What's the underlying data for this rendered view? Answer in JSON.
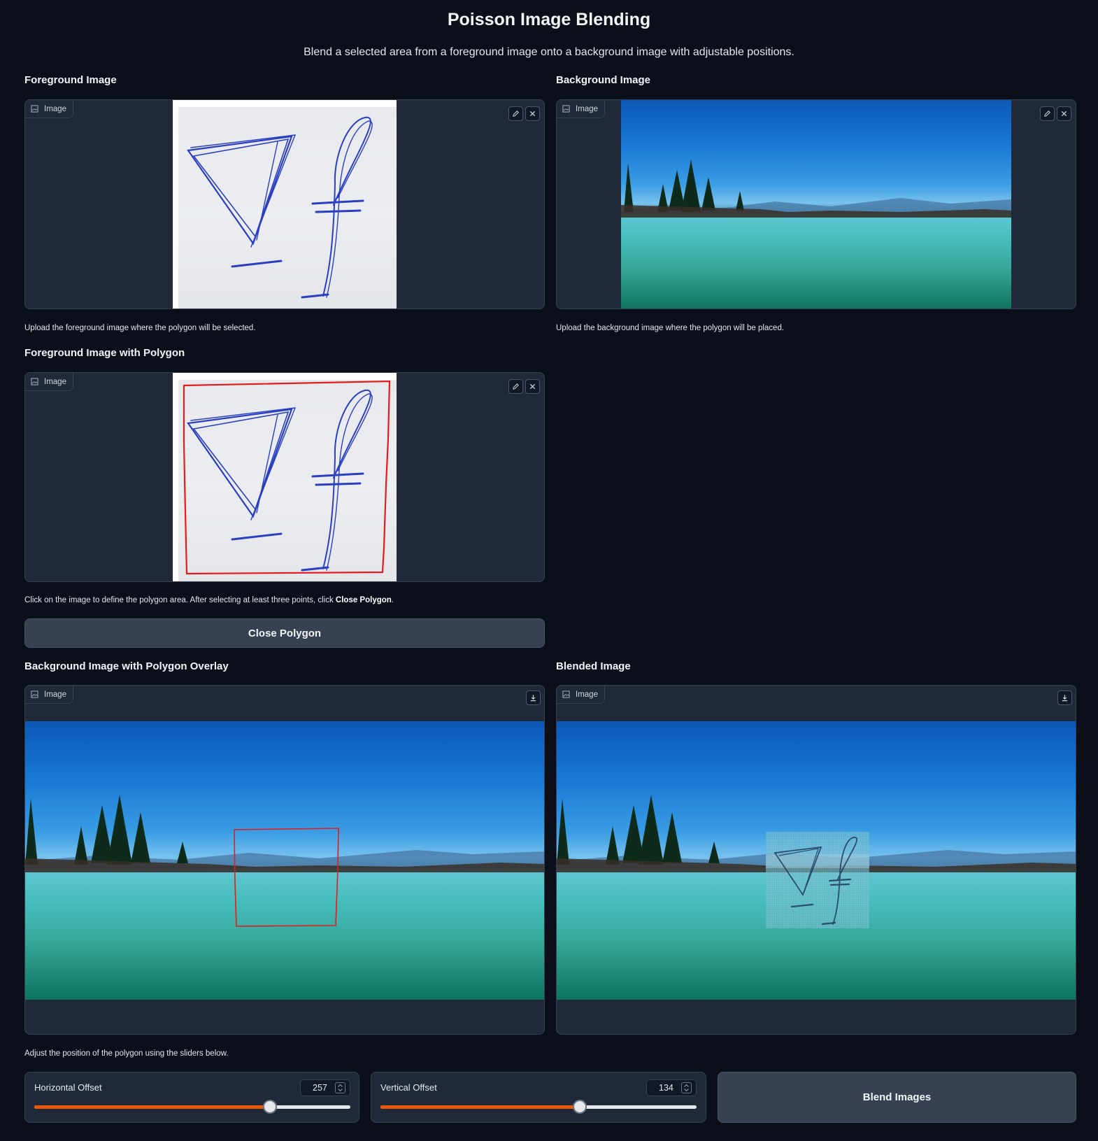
{
  "page": {
    "title": "Poisson Image Blending",
    "subtitle": "Blend a selected area from a foreground image onto a background image with adjustable positions."
  },
  "foreground": {
    "label": "Foreground Image",
    "badge": "Image",
    "hint": "Upload the foreground image where the polygon will be selected."
  },
  "background": {
    "label": "Background Image",
    "badge": "Image",
    "hint": "Upload the background image where the polygon will be placed."
  },
  "polygon": {
    "label": "Foreground Image with Polygon",
    "badge": "Image",
    "hint_prefix": "Click on the image to define the polygon area. After selecting at least three points, click ",
    "hint_bold": "Close Polygon",
    "hint_suffix": ".",
    "close_button": "Close Polygon"
  },
  "overlay": {
    "label": "Background Image with Polygon Overlay",
    "badge": "Image"
  },
  "blended": {
    "label": "Blended Image",
    "badge": "Image"
  },
  "controls": {
    "hint": "Adjust the position of the polygon using the sliders below.",
    "horizontal": {
      "label": "Horizontal Offset",
      "value": "257",
      "fraction": 0.745
    },
    "vertical": {
      "label": "Vertical Offset",
      "value": "134",
      "fraction": 0.63
    },
    "blend_button": "Blend Images"
  },
  "colors": {
    "background": "#0b0f19",
    "panel": "#1f2937",
    "accent": "#ea580c",
    "polygon_stroke": "#e11d1d"
  },
  "icons": [
    "image-icon",
    "edit-icon",
    "close-icon",
    "download-icon",
    "spinner-arrows-icon"
  ]
}
